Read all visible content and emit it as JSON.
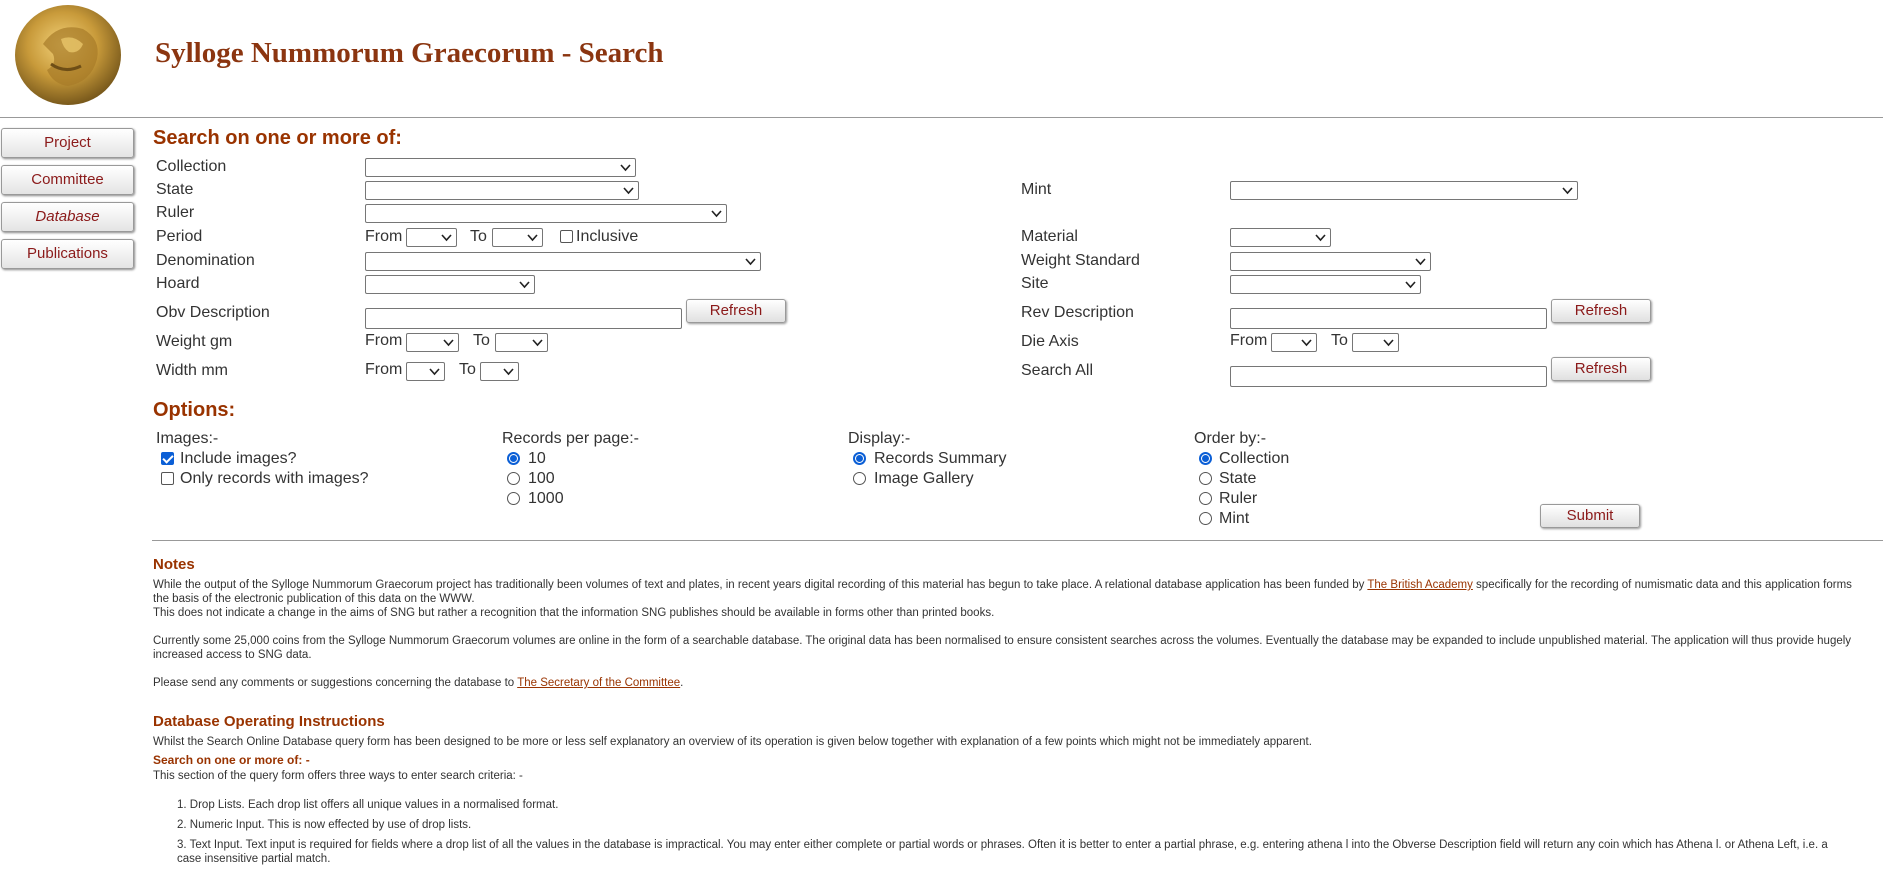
{
  "site": {
    "title": "Sylloge Nummorum Graecorum - Search"
  },
  "nav": {
    "items": [
      {
        "label": "Project"
      },
      {
        "label": "Committee"
      },
      {
        "label": "Database"
      },
      {
        "label": "Publications"
      }
    ]
  },
  "search": {
    "heading": "Search on one or more of:",
    "collection": "Collection",
    "state": "State",
    "ruler": "Ruler",
    "period": "Period",
    "denomination": "Denomination",
    "hoard": "Hoard",
    "obv_description": "Obv Description",
    "weight": "Weight gm",
    "width": "Width mm",
    "mint": "Mint",
    "material": "Material",
    "weight_standard": "Weight Standard",
    "site": "Site",
    "rev_description": "Rev Description",
    "die_axis": "Die Axis",
    "search_all": "Search All",
    "from": "From",
    "to": "To",
    "inclusive": "Inclusive",
    "refresh": "Refresh"
  },
  "options": {
    "heading": "Options:",
    "images_label": "Images:-",
    "include_images": "Include images?",
    "only_images": "Only records with images?",
    "records_label": "Records per page:-",
    "records": [
      "10",
      "100",
      "1000"
    ],
    "display_label": "Display:-",
    "display": [
      "Records Summary",
      "Image Gallery"
    ],
    "order_label": "Order by:-",
    "order": [
      "Collection",
      "State",
      "Ruler",
      "Mint"
    ],
    "submit": "Submit"
  },
  "notes": {
    "heading": "Notes",
    "p1_a": "While the output of the Sylloge Nummorum Graecorum project has traditionally been volumes of text and plates, in recent years digital recording of this material has begun to take place. A relational database application has been funded by ",
    "p1_link": "The British Academy",
    "p1_b": " specifically for the recording of numismatic data and this application forms the basis of the electronic publication of this data on the WWW.",
    "p2": "This does not indicate a change in the aims of SNG but rather a recognition that the information SNG publishes should be available in forms other than printed books.",
    "p3": "Currently some 25,000 coins from the Sylloge Nummorum Graecorum volumes are online in the form of a searchable database. The original data has been normalised to ensure consistent searches across the volumes. Eventually the database may be expanded to include unpublished material. The application will thus provide hugely increased access to SNG data.",
    "p4_a": "Please send any comments or suggestions concerning the database to ",
    "p4_link": "The Secretary of the Committee",
    "p4_b": "."
  },
  "instructions": {
    "heading": "Database Operating Instructions",
    "intro": "Whilst the Search Online Database query form has been designed to be more or less self explanatory an overview of its operation is given below together with explanation of a few points which might not be immediately apparent.",
    "subheading": "Search on one or more of: -",
    "sub_intro": "This section of the query form offers three ways to enter search criteria: -",
    "items": [
      "1.  Drop Lists. Each drop list offers all unique values in a normalised format.",
      "2.  Numeric Input. This is now effected by use of drop lists.",
      "3.  Text Input. Text input is required for fields where a drop list of all the values in the database is impractical. You may enter either complete or partial words or phrases. Often it is better to enter a partial phrase, e.g. entering athena l into the Obverse Description field will return any coin which has Athena l. or Athena Left, i.e. a case insensitive partial match."
    ]
  }
}
